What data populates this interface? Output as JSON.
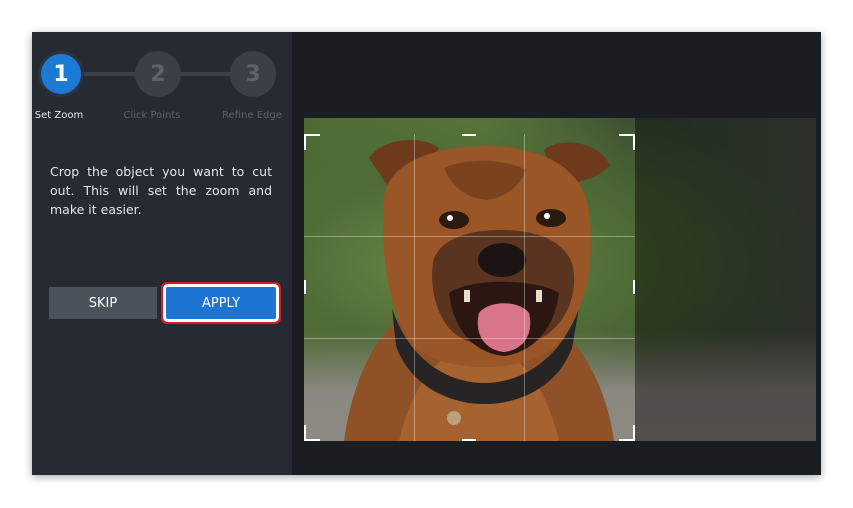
{
  "steps": [
    {
      "number": "1",
      "label": "Set Zoom",
      "active": true
    },
    {
      "number": "2",
      "label": "Click Points",
      "active": false
    },
    {
      "number": "3",
      "label": "Refine Edge",
      "active": false
    }
  ],
  "instructions": "Crop the object you want to cut out. This will set the zoom and make it easier.",
  "buttons": {
    "skip": "SKIP",
    "apply": "APPLY"
  },
  "colors": {
    "accent": "#1e74d2",
    "highlight": "#d11f2a",
    "sidebar": "#252a33"
  },
  "image": {
    "subject": "dog-photo",
    "crop_grid": "3x3"
  }
}
